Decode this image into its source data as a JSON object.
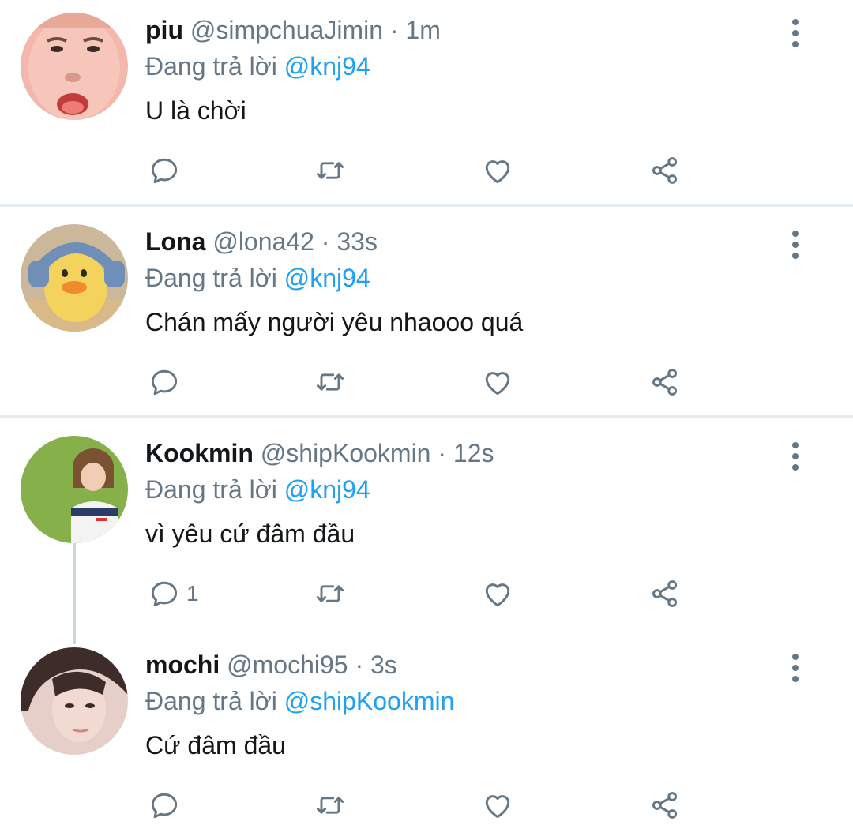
{
  "colors": {
    "accent": "#1da1f2",
    "muted": "#657786",
    "text": "#14171a",
    "separator": "#e6ecf0"
  },
  "reply_prefix": "Đang trả lời",
  "tweets": [
    {
      "name": "piu",
      "handle": "@simpchuaJimin",
      "time": "· 1m",
      "reply_to": "@knj94",
      "text": "U là chời",
      "reply_count": ""
    },
    {
      "name": "Lona",
      "handle": "@lona42",
      "time": "· 33s",
      "reply_to": "@knj94",
      "text": "Chán mấy người yêu nhaooo quá",
      "reply_count": ""
    },
    {
      "name": "Kookmin",
      "handle": "@shipKookmin",
      "time": "· 12s",
      "reply_to": "@knj94",
      "text": "vì yêu cứ đâm đầu",
      "reply_count": "1"
    },
    {
      "name": "mochi",
      "handle": "@mochi95",
      "time": "· 3s",
      "reply_to": "@shipKookmin",
      "text": "Cứ đâm đầu",
      "reply_count": ""
    }
  ],
  "icons": [
    "reply-icon",
    "retweet-icon",
    "like-icon",
    "share-icon",
    "more-options-icon"
  ]
}
